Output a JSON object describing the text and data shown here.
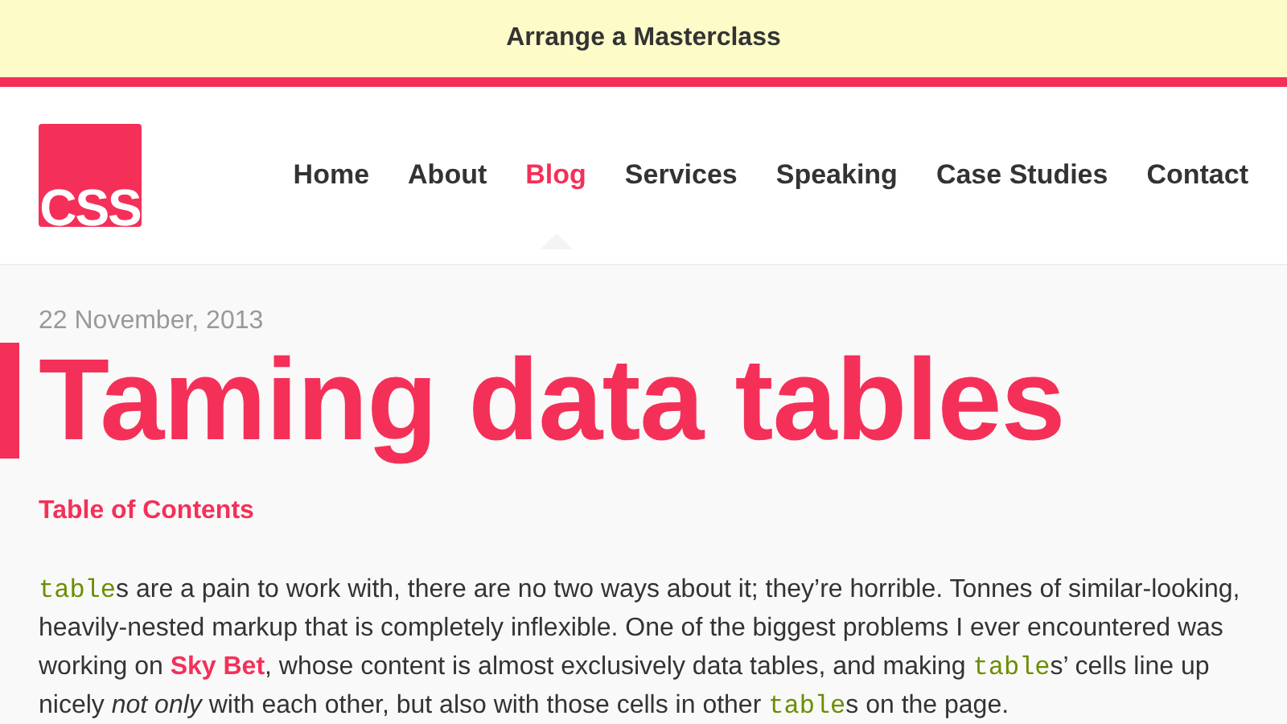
{
  "banner": {
    "text": "Arrange a Masterclass"
  },
  "header": {
    "logo": "CSS",
    "nav": [
      {
        "label": "Home",
        "selected": false
      },
      {
        "label": "About",
        "selected": false
      },
      {
        "label": "Blog",
        "selected": true
      },
      {
        "label": "Services",
        "selected": false
      },
      {
        "label": "Speaking",
        "selected": false
      },
      {
        "label": "Case Studies",
        "selected": false
      },
      {
        "label": "Contact",
        "selected": false
      }
    ]
  },
  "article": {
    "date": "22 November, 2013",
    "title": "Taming data tables",
    "toc": "Table of Contents",
    "paragraph": [
      {
        "kind": "code",
        "text": "table"
      },
      {
        "kind": "text",
        "text": "s are a pain to work with, there are no two ways about it; they’re horrible. Tonnes of similar-looking, heavily-nested markup that is completely inflexible. One of the biggest problems I ever encountered was working on "
      },
      {
        "kind": "link",
        "text": "Sky Bet"
      },
      {
        "kind": "text",
        "text": ", whose content is almost exclusively data tables, and making "
      },
      {
        "kind": "code",
        "text": "table"
      },
      {
        "kind": "text",
        "text": "s’ cells line up nicely "
      },
      {
        "kind": "em",
        "text": "not only"
      },
      {
        "kind": "text",
        "text": " with each other, but also with those cells in other "
      },
      {
        "kind": "code",
        "text": "table"
      },
      {
        "kind": "text",
        "text": "s on the page."
      }
    ]
  }
}
